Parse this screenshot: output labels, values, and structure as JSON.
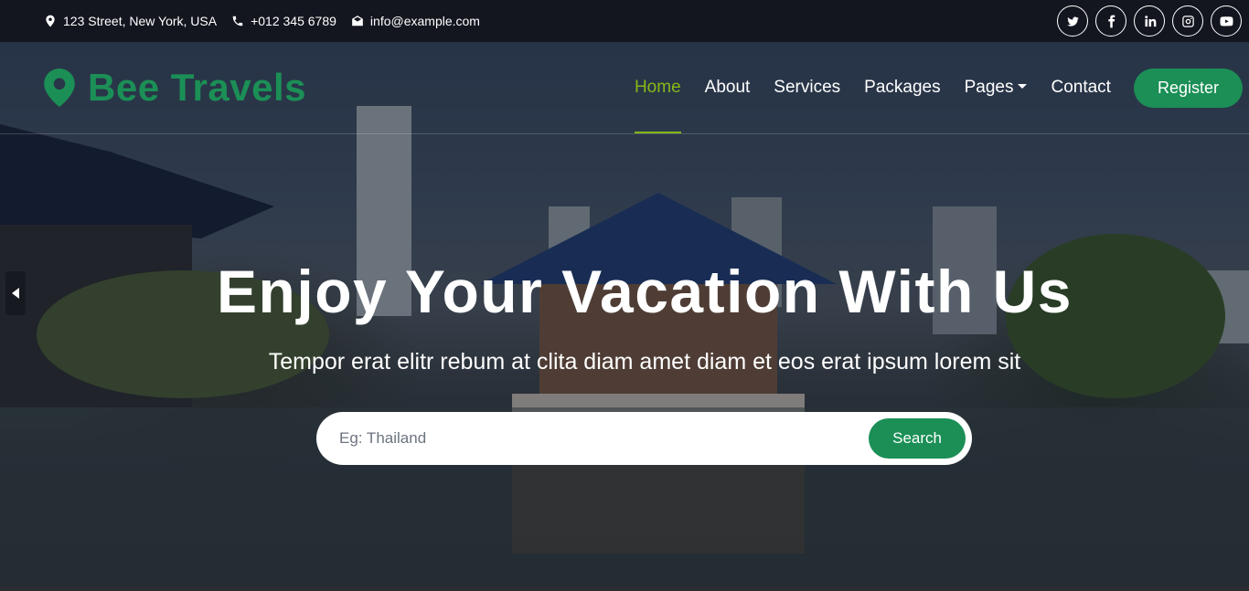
{
  "topbar": {
    "address": "123 Street, New York, USA",
    "phone": "+012 345 6789",
    "email": "info@example.com",
    "socials": [
      "twitter-icon",
      "facebook-icon",
      "linkedin-icon",
      "instagram-icon",
      "youtube-icon"
    ]
  },
  "navbar": {
    "brand": "Bee Travels",
    "links": [
      {
        "label": "Home",
        "active": true
      },
      {
        "label": "About"
      },
      {
        "label": "Services"
      },
      {
        "label": "Packages"
      },
      {
        "label": "Pages",
        "dropdown": true
      },
      {
        "label": "Contact"
      }
    ],
    "register_label": "Register"
  },
  "hero": {
    "title": "Enjoy Your Vacation With Us",
    "subtitle": "Tempor erat elitr rebum at clita diam amet diam et eos erat ipsum lorem sit",
    "search": {
      "placeholder": "Eg: Thailand",
      "button_label": "Search"
    }
  },
  "colors": {
    "accent": "#1b8f56",
    "active_nav": "#86b817",
    "topbar_bg": "#13151f"
  }
}
